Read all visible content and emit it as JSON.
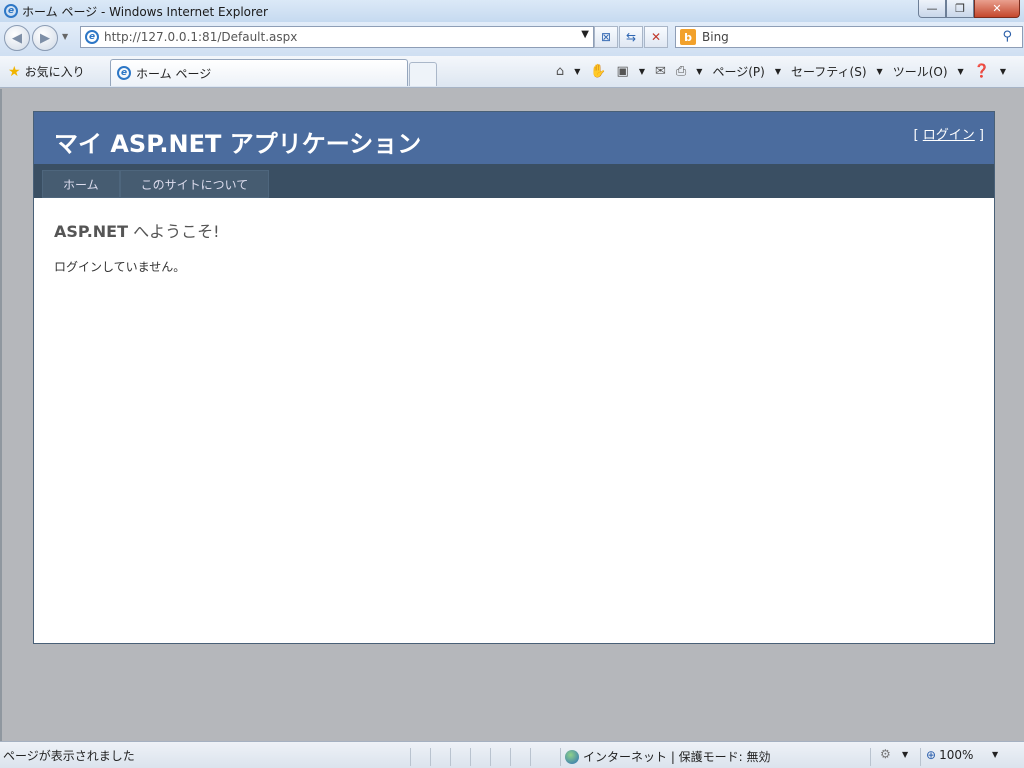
{
  "window": {
    "title": "ホーム ページ - Windows Internet Explorer",
    "controls": {
      "minimize": "—",
      "restore": "❐",
      "close": "✕"
    }
  },
  "nav": {
    "back_icon": "back-arrow",
    "forward_icon": "forward-arrow",
    "address": "http://127.0.0.1:81/Default.aspx",
    "search_provider": "Bing"
  },
  "favbar": {
    "favorites": "お気に入り",
    "tab_title": "ホーム ページ",
    "commands": {
      "page": "ページ(P)",
      "safety": "セーフティ(S)",
      "tools": "ツール(O)"
    }
  },
  "page": {
    "app_title": "マイ ASP.NET アプリケーション",
    "login_bracket_open": "[ ",
    "login_link": "ログイン",
    "login_bracket_close": " ]",
    "menu": [
      "ホーム",
      "このサイトについて"
    ],
    "welcome_bold": "ASP.NET",
    "welcome_rest": " へようこそ!",
    "message": "ログインしていません。"
  },
  "status": {
    "text": "ページが表示されました",
    "zone": "インターネット | 保護モード: 無効",
    "zoom": "100%"
  },
  "colors": {
    "header": "#4b6c9e",
    "menu_bar": "#3a4f63",
    "menu_item": "#465c71",
    "background": "#b5b7bb"
  }
}
